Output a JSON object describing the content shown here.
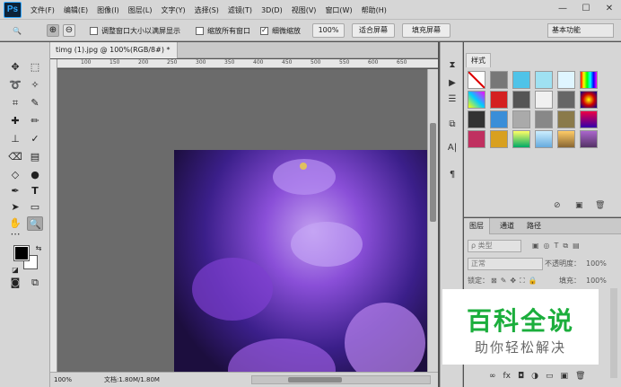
{
  "app": {
    "logo": "Ps",
    "menu": [
      "文件(F)",
      "编辑(E)",
      "图像(I)",
      "图层(L)",
      "文字(Y)",
      "选择(S)",
      "滤镜(T)",
      "3D(D)",
      "视图(V)",
      "窗口(W)",
      "帮助(H)"
    ],
    "window_controls": [
      "—",
      "☐",
      "✕"
    ]
  },
  "options": {
    "zoom_icon": "🔍",
    "zoom_in_icon": "⊕",
    "zoom_out_icon": "⊖",
    "resize_windows": "调整窗口大小以满屏显示",
    "zoom_all_windows": "缩放所有窗口",
    "scrubby_zoom": "细微缩放",
    "zoom_value": "100%",
    "fit_screen": "适合屏幕",
    "fill_screen": "填充屏幕",
    "workspace": "基本功能"
  },
  "document": {
    "tab_title": "timg (1).jpg @ 100%(RGB/8#) *",
    "close_icon": "×",
    "ruler_marks": [
      "100",
      "150",
      "200",
      "250",
      "300",
      "350",
      "400",
      "450",
      "500",
      "550",
      "600",
      "650"
    ]
  },
  "status": {
    "zoom": "100%",
    "doc_info": "文档:1.80M/1.80M"
  },
  "styles_panel": {
    "tab": "样式"
  },
  "layers_panel": {
    "tabs": [
      "图层",
      "通道",
      "路径"
    ],
    "filter_label": "ρ 类型",
    "blend_mode": "正常",
    "opacity_label": "不透明度：",
    "opacity_value": "100%",
    "lock_label": "锁定：",
    "fill_label": "填充：",
    "fill_value": "100%",
    "footer_icons": [
      "∞",
      "fx",
      "◘",
      "◑",
      "▭",
      "▣",
      "🗑"
    ]
  },
  "watermark": {
    "title": "百科全说",
    "subtitle": "助你轻松解决"
  },
  "colors": {
    "chrome": "#d6d6d6",
    "canvas_bg": "#6b6b6b",
    "watermark_green": "#1bae3c"
  }
}
